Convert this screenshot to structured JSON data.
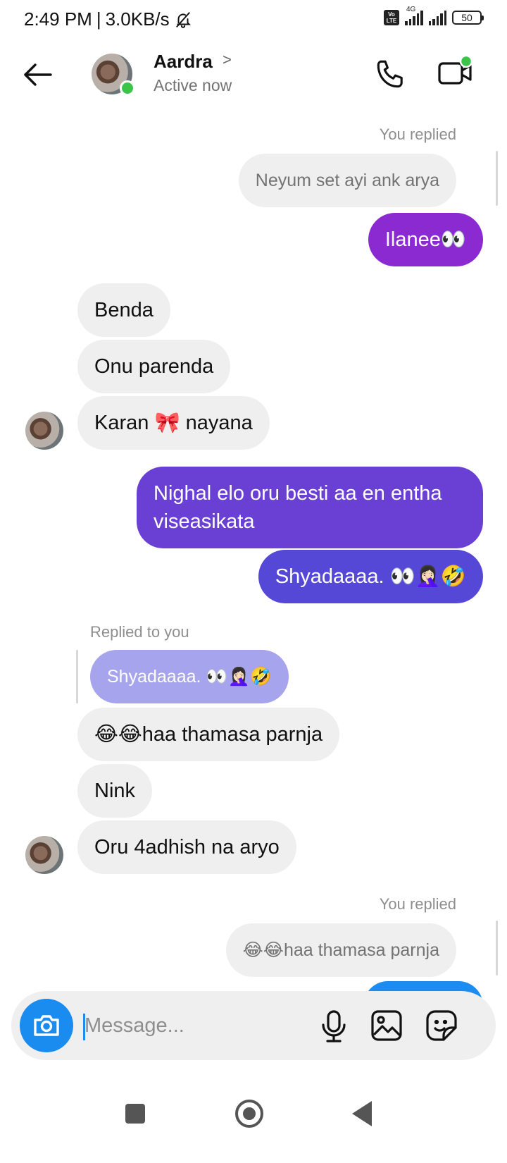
{
  "status_bar": {
    "time": "2:49 PM",
    "separator": "|",
    "speed": "3.0KB/s",
    "network_label": "4G",
    "volte_label": "Vo LTE",
    "battery": "50"
  },
  "header": {
    "contact_name": "Aardra",
    "chevron": ">",
    "status": "Active now"
  },
  "messages": {
    "ctx1": "You replied",
    "quoted1": "Neyum set ayi ank arya",
    "sent1": "Ilanee👀",
    "recv1": "Benda",
    "recv2": "Onu parenda",
    "recv3": "Karan 🎀 nayana",
    "sent2": "Nighal elo oru besti aa en entha viseasikata",
    "sent3": "Shyadaaaa. 👀🤦🏻‍♀️🤣",
    "ctx2": "Replied to you",
    "quoted2": "Shyadaaaa. 👀🤦🏻‍♀️🤣",
    "recv4": "😂😂haa thamasa parnja",
    "recv5": "Nink",
    "recv6": "Oru 4adhish na aryo",
    "ctx3": "You replied",
    "quoted3": "😂😂haa thamasa parnja"
  },
  "composer": {
    "placeholder": "Message..."
  },
  "colors": {
    "accent_blue": "#1a8cf0",
    "sent_purple": "#8b2ad0",
    "sent_indigo": "#6a40d4",
    "online_green": "#3ac44a"
  },
  "icons": {
    "back": "arrow-left-icon",
    "call": "phone-icon",
    "video": "video-camera-icon",
    "camera": "camera-icon",
    "mic": "microphone-icon",
    "gallery": "image-icon",
    "sticker": "sticker-icon",
    "mute": "bell-off-icon"
  }
}
